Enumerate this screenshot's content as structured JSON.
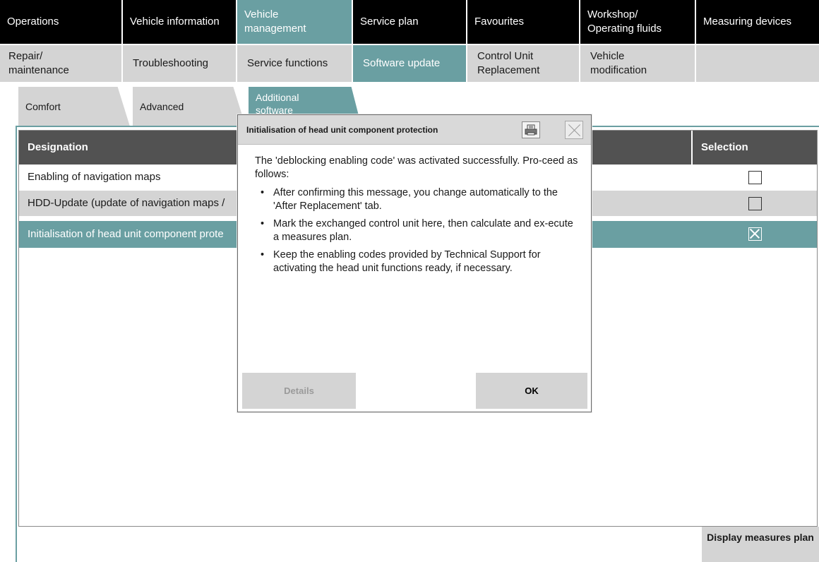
{
  "top_nav": {
    "tabs": [
      {
        "label": "Operations"
      },
      {
        "label": "Vehicle information"
      },
      {
        "label": "Vehicle management",
        "active": true
      },
      {
        "label": "Service plan"
      },
      {
        "label": "Favourites"
      },
      {
        "label": "Workshop/ Operating fluids"
      },
      {
        "label": "Measuring devices"
      }
    ]
  },
  "sub_nav": {
    "tabs": [
      {
        "label": "Repair/ maintenance"
      },
      {
        "label": "Troubleshooting"
      },
      {
        "label": "Service functions"
      },
      {
        "label": "Software update",
        "active": true
      },
      {
        "label": "Control Unit Replacement"
      },
      {
        "label": "Vehicle modification"
      },
      {
        "label": ""
      }
    ]
  },
  "category_tabs": [
    {
      "label": "Comfort"
    },
    {
      "label": "Advanced"
    },
    {
      "label": "Additional software",
      "active": true
    }
  ],
  "table": {
    "headers": {
      "designation": "Designation",
      "selection": "Selection"
    },
    "rows": [
      {
        "designation": "Enabling of navigation maps",
        "selected": false
      },
      {
        "designation": "HDD-Update (update of navigation maps /",
        "selected": false
      },
      {
        "designation": "Initialisation of head unit component prote",
        "selected": true
      }
    ]
  },
  "footer": {
    "measures_label": "Display measures plan"
  },
  "dialog": {
    "title": "Initialisation of head unit component protection",
    "intro": "The 'deblocking enabling code' was activated successfully. Pro-ceed as follows:",
    "bullets": [
      "After confirming this message, you change automatically to the 'After Replacement' tab.",
      "Mark the exchanged control unit here, then calculate and ex-ecute a measures plan.",
      "Keep the enabling codes provided by Technical Support for activating the head unit functions ready, if necessary."
    ],
    "details_label": "Details",
    "ok_label": "OK",
    "icons": {
      "print": "print-icon",
      "close": "close-icon"
    }
  },
  "colors": {
    "accent": "#6a9fa2",
    "nav_bg": "#000000",
    "tab_grey": "#d4d4d4",
    "header_bg": "#525252"
  }
}
